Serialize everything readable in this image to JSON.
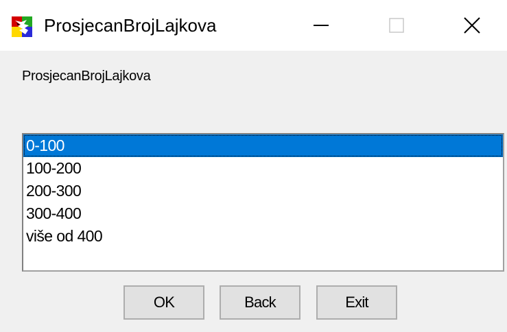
{
  "window": {
    "title": "ProsjecanBrojLajkova",
    "icon": "app-icon-colorful-splash",
    "caption_buttons": {
      "minimize": "minimize-icon",
      "maximize": "maximize-icon",
      "close": "close-icon"
    }
  },
  "form": {
    "label": "ProsjecanBrojLajkova",
    "listbox": {
      "items": [
        {
          "label": "0-100",
          "selected": true
        },
        {
          "label": "100-200",
          "selected": false
        },
        {
          "label": "200-300",
          "selected": false
        },
        {
          "label": "300-400",
          "selected": false
        },
        {
          "label": "više od 400",
          "selected": false
        }
      ]
    },
    "buttons": {
      "ok": "OK",
      "back": "Back",
      "exit": "Exit"
    }
  },
  "colors": {
    "selection": "#0078d7",
    "window_bg": "#f0f0f0",
    "titlebar_bg": "#ffffff"
  }
}
